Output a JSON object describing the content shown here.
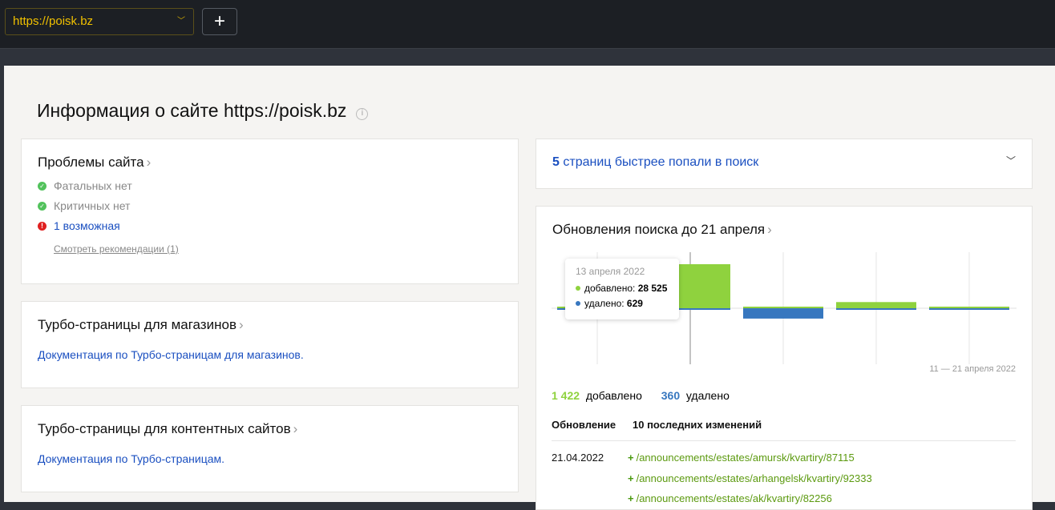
{
  "topbar": {
    "site": "https://poisk.bz",
    "add_label": "+"
  },
  "page": {
    "title": "Информация о сайте https://poisk.bz",
    "info_icon": "i"
  },
  "problems": {
    "title": "Проблемы сайта",
    "items": [
      {
        "text": "Фатальных нет",
        "status": "ok"
      },
      {
        "text": "Критичных нет",
        "status": "ok"
      },
      {
        "text": "1 возможная",
        "status": "error"
      }
    ],
    "link": "Смотреть рекомендации (1)"
  },
  "turbo_shops": {
    "title": "Турбо-страницы для магазинов",
    "link": "Документация по Турбо-страницам для магазинов."
  },
  "turbo_content": {
    "title": "Турбо-страницы для контентных сайтов",
    "link": "Документация по Турбо-страницам."
  },
  "fast_pages": {
    "count": "5",
    "text": "страниц быстрее попали в поиск"
  },
  "updates": {
    "title": "Обновления поиска до 21 апреля",
    "range": "11 — 21 апреля 2022",
    "added_count": "1 422",
    "added_label": "добавлено",
    "removed_count": "360",
    "removed_label": "удалено",
    "col_update": "Обновление",
    "col_changes": "10 последних изменений",
    "rows": [
      {
        "date": "21.04.2022",
        "urls": [
          "/announcements/estates/amursk/kvartiry/87115",
          "/announcements/estates/arhangelsk/kvartiry/92333",
          "/announcements/estates/ak/kvartiry/82256"
        ]
      }
    ],
    "tooltip": {
      "date": "13 апреля 2022",
      "added": "добавлено: ",
      "added_val": "28 525",
      "removed": "удалено: ",
      "removed_val": "629"
    }
  },
  "chart_data": {
    "type": "bar",
    "title": "Обновления поиска до 21 апреля",
    "series": [
      {
        "name": "добавлено",
        "color": "#8fd23e",
        "values": [
          900,
          28525,
          1000,
          4000,
          1000
        ]
      },
      {
        "name": "удалено",
        "color": "#3777bf",
        "values": [
          700,
          629,
          6700,
          600,
          600
        ]
      }
    ],
    "highlighted_index": 1
  }
}
